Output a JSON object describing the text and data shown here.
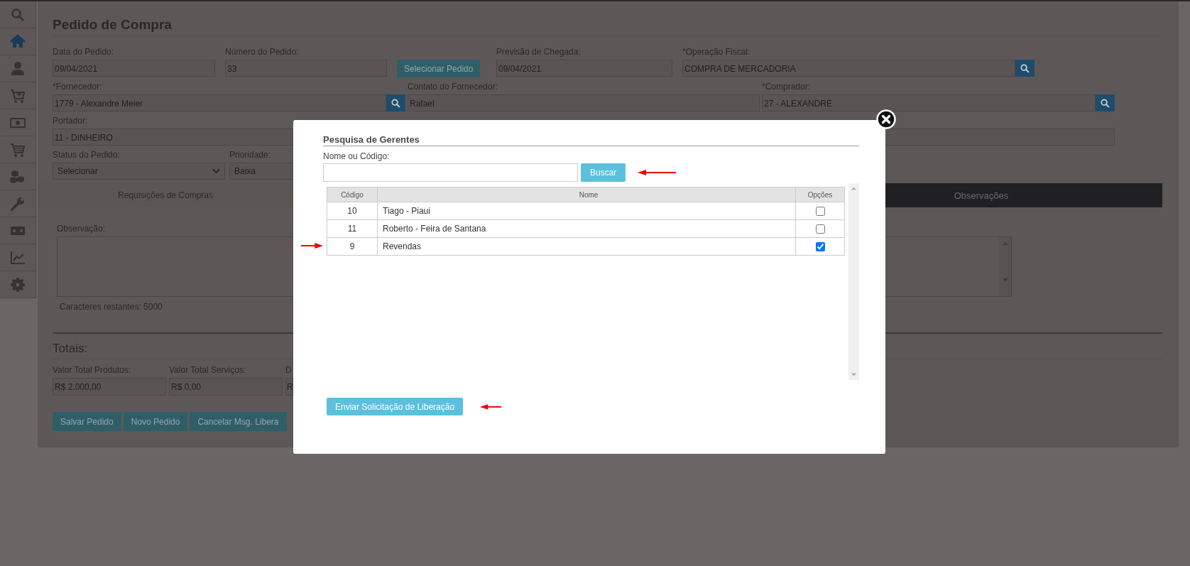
{
  "sidebar": {
    "items": [
      {
        "kind": "search",
        "selected": false
      },
      {
        "kind": "home",
        "selected": true
      },
      {
        "kind": "user",
        "selected": false
      },
      {
        "kind": "cart-plus",
        "selected": false
      },
      {
        "kind": "money",
        "selected": false
      },
      {
        "kind": "cart",
        "selected": false
      },
      {
        "kind": "cubes",
        "selected": false
      },
      {
        "kind": "wrench",
        "selected": false
      },
      {
        "kind": "ticket",
        "selected": false
      },
      {
        "kind": "chart",
        "selected": false
      },
      {
        "kind": "gear",
        "selected": false
      }
    ]
  },
  "page_title": "Pedido de Compra",
  "form_rows": [
    [
      {
        "kind": "input",
        "label": "Data do Pedido:",
        "value": "09/04/2021"
      },
      {
        "kind": "input",
        "label": "Número do Pedido:",
        "value": "33"
      },
      {
        "kind": "button",
        "value": "Selecionar Pedido"
      },
      {
        "kind": "input",
        "label": "Previsão de Chegada:",
        "value": "09/04/2021"
      },
      {
        "kind": "lookup",
        "label": "*Operação Fiscal:",
        "value": "COMPRA DE MERCADORIA"
      }
    ],
    [
      {
        "kind": "lookup",
        "label": "*Fornecedor:",
        "value": "1779 - Alexandre Meier"
      },
      {
        "kind": "input",
        "label": "Contato do Fornecedor:",
        "value": "Rafael"
      },
      {
        "kind": "lookup",
        "label": "*Comprador:",
        "value": "27 - ALEXANDRE"
      }
    ],
    [
      {
        "kind": "input",
        "label": "Portador:",
        "value": "11 - DINHEIRO"
      },
      {
        "kind": "blank"
      },
      {
        "kind": "input"
      }
    ],
    [
      {
        "kind": "select",
        "label": "Status do Pedido:",
        "value": "Selecionar"
      },
      {
        "kind": "select",
        "label": "Prioridade:",
        "value": "Baixa"
      }
    ]
  ],
  "tabs": [
    {
      "label": "Requisições de Compras",
      "selected": false
    },
    {
      "label": "Observações",
      "selected": true
    }
  ],
  "observation": {
    "label": "Observação:",
    "remaining": "Caracteres restantes: 5000"
  },
  "totals": {
    "title": "Totais:",
    "fields": [
      {
        "label": "Valor Total Produtos:",
        "value": "R$ 2.000,00"
      },
      {
        "label": "Valor Total Serviços:",
        "value": "R$ 0,00"
      },
      {
        "label": "D",
        "value": "R"
      }
    ]
  },
  "actions": [
    "Salvar Pedido",
    "Novo Pedido",
    "Cancelar Msg. Libera"
  ],
  "modal": {
    "title": "Pesquisa de Gerentes",
    "search_label": "Nome ou Código:",
    "search_button": "Buscar",
    "table": {
      "columns": [
        "Código",
        "Nome",
        "Opções"
      ],
      "rows": [
        {
          "code": "10",
          "name": "Tiago - Piaui",
          "checked": false
        },
        {
          "code": "11",
          "name": "Roberto - Feira de Santana",
          "checked": false
        },
        {
          "code": "9",
          "name": "Revendas",
          "checked": true
        }
      ]
    },
    "submit_button": "Enviar Solicitação de Liberação"
  }
}
